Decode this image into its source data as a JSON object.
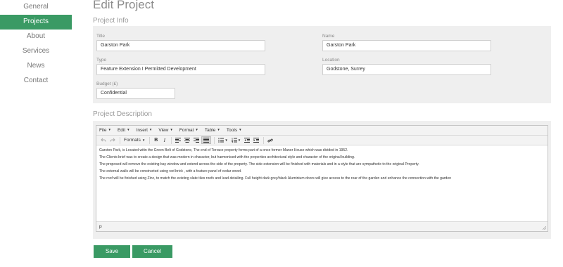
{
  "sidebar": {
    "items": [
      {
        "label": "General"
      },
      {
        "label": "Projects"
      },
      {
        "label": "About"
      },
      {
        "label": "Services"
      },
      {
        "label": "News"
      },
      {
        "label": "Contact"
      }
    ],
    "active_index": 1
  },
  "page": {
    "title": "Edit Project"
  },
  "project_info": {
    "section_title": "Project Info",
    "fields": {
      "title": {
        "label": "Title",
        "value": "Garston Park"
      },
      "name": {
        "label": "Name",
        "value": "Garston Park"
      },
      "type": {
        "label": "Type",
        "value": "Feature Extension I Permitted Development"
      },
      "location": {
        "label": "Location",
        "value": "Godstone, Surrey"
      },
      "budget": {
        "label": "Budget (£)",
        "value": "Confidential"
      }
    }
  },
  "project_description": {
    "section_title": "Project Description",
    "menubar": [
      "File",
      "Edit",
      "Insert",
      "View",
      "Format",
      "Table",
      "Tools"
    ],
    "toolbar": {
      "formats_label": "Formats"
    },
    "paragraphs": [
      "Garston Park, is Located witin the Green Belt of Godstone, The end of Terrace property forms part of a once former Manor House which was divided  in 1952.",
      "The Clients brief was to create a design that was  modern in character, but harmonised with the properties architectural style and character of the original building.",
      "The proposed will remove the existing bay window and extend across the side of the property. The side extension will be finished with materials and in a style that are sympathetic to the original Property.",
      "The external walls will be constructed using red brick , with a  feature panel of cedar wood.",
      "The roof will be finished using Zinc, to match the existing slate tiles roofs and lead detailing. Full height dark grey/black Aluminium doors will give access to the rear of the garden and enhance the connection with the garden"
    ],
    "status_path": "p"
  },
  "actions": {
    "save_label": "Save",
    "cancel_label": "Cancel"
  },
  "colors": {
    "accent": "#3a9a64",
    "panel": "#efefef"
  },
  "icons": [
    "undo-icon",
    "redo-icon",
    "bold-icon",
    "italic-icon",
    "align-left-icon",
    "align-center-icon",
    "align-right-icon",
    "align-justify-icon",
    "bullet-list-icon",
    "numbered-list-icon",
    "outdent-icon",
    "indent-icon",
    "link-icon",
    "resize-handle-icon"
  ]
}
